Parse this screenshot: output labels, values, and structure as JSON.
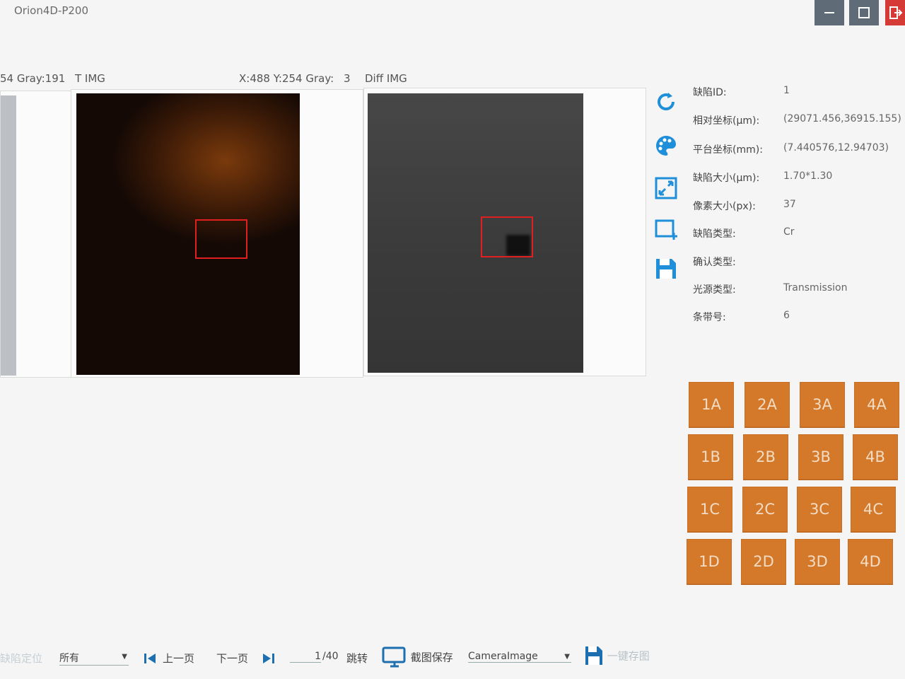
{
  "app": {
    "title": "Orion4D-P200"
  },
  "window_buttons": {
    "minimize": "minimize-icon",
    "maximize": "maximize-icon",
    "exit": "exit-icon"
  },
  "header": {
    "left_info": "54 Gray:191",
    "t_label": "T IMG",
    "coord_info": "X:488 Y:254 Gray:",
    "gray_value": "3",
    "diff_label": "Diff IMG"
  },
  "tools": [
    "refresh-icon",
    "palette-icon",
    "fit-screen-icon",
    "roi-select-icon",
    "save-icon"
  ],
  "defect": {
    "rows": [
      {
        "label": "缺陷ID:",
        "value": "1"
      },
      {
        "label": "相对坐标(μm):",
        "value": "(29071.456,36915.155)"
      },
      {
        "label": "平台坐标(mm):",
        "value": "(7.440576,12.94703)"
      },
      {
        "label": "缺陷大小(μm):",
        "value": "1.70*1.30"
      },
      {
        "label": "像素大小(px):",
        "value": "37"
      },
      {
        "label": "缺陷类型:",
        "value": "Cr"
      },
      {
        "label": "确认类型:",
        "value": ""
      },
      {
        "label": "光源类型:",
        "value": "Transmission"
      },
      {
        "label": "条带号:",
        "value": "6"
      }
    ]
  },
  "grid": [
    [
      "1A",
      "2A",
      "3A",
      "4A"
    ],
    [
      "1B",
      "2B",
      "3B",
      "4B"
    ],
    [
      "1C",
      "2C",
      "3C",
      "4C"
    ],
    [
      "1D",
      "2D",
      "3D",
      "4D"
    ]
  ],
  "colors": {
    "grid_button": "#d4782a",
    "roi": "#e02020",
    "exit": "#d63a36"
  },
  "bottom": {
    "faded_label": "缺陷定位",
    "filter_value": "所有",
    "prev_label": "上一页",
    "next_label": "下一页",
    "page_current": "1",
    "page_total": "/40",
    "jump_label": "跳转",
    "screenshot_label": "截图保存",
    "image_select_value": "CameraImage",
    "save_all_label": "一键存图"
  }
}
